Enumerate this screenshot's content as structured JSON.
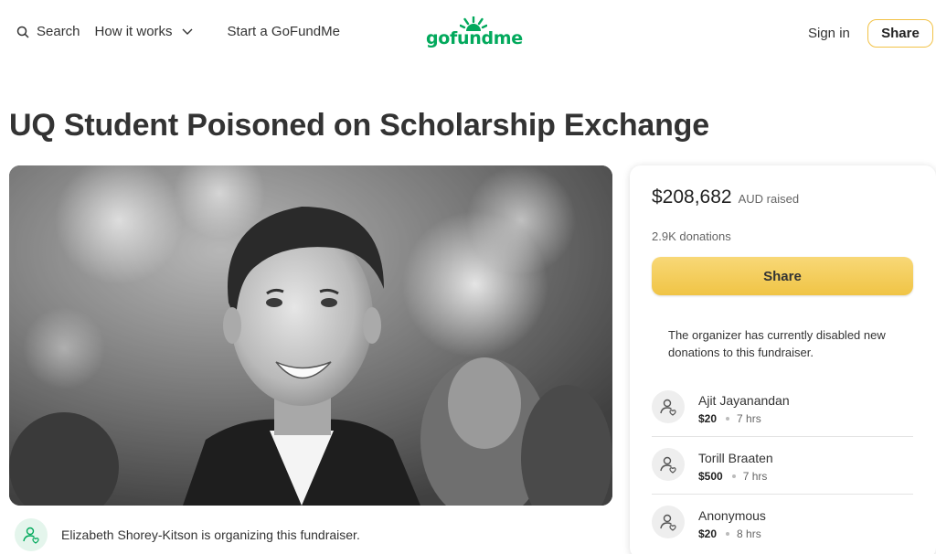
{
  "header": {
    "search_label": "Search",
    "how_it_works_label": "How it works",
    "start_label": "Start a GoFundMe",
    "logo_text": "gofundme",
    "signin_label": "Sign in",
    "share_label": "Share",
    "brand_color": "#02a95c"
  },
  "campaign": {
    "title": "UQ Student Poisoned on Scholarship Exchange",
    "organizer_text": "Elizabeth Shorey-Kitson is organizing this fundraiser."
  },
  "donation_card": {
    "raised_amount": "$208,682",
    "raised_label": "AUD raised",
    "donation_count": "2.9K donations",
    "share_label": "Share",
    "notice": "The organizer has currently disabled new donations to this fundraiser.",
    "donations": [
      {
        "name": "Ajit Jayanandan",
        "amount": "$20",
        "time": "7 hrs"
      },
      {
        "name": "Torill Braaten",
        "amount": "$500",
        "time": "7 hrs"
      },
      {
        "name": "Anonymous",
        "amount": "$20",
        "time": "8 hrs"
      }
    ],
    "accent_color": "#f2c246"
  },
  "icons": {
    "search": "search-icon",
    "chevron": "chevron-down-icon",
    "donor": "heart-hand-icon"
  }
}
